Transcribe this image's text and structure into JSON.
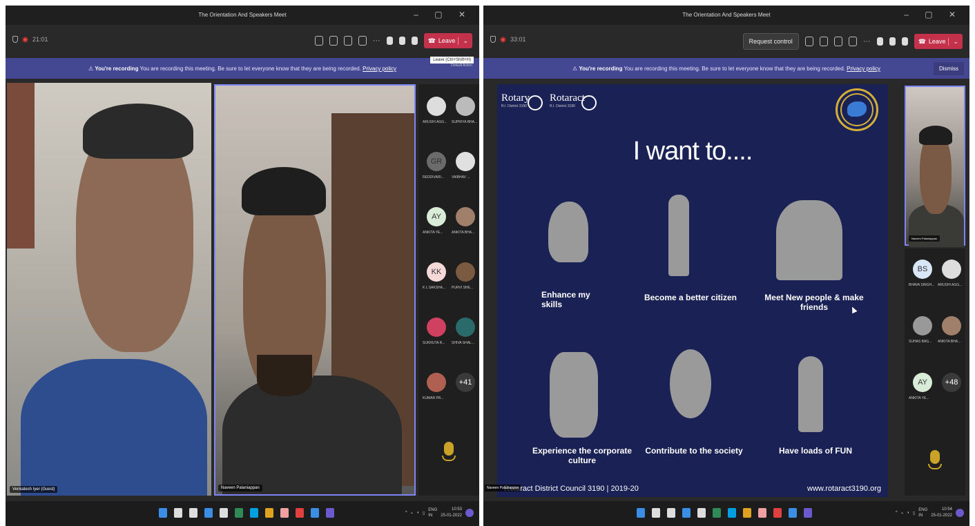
{
  "left_window": {
    "title": "The Orientation And Speakers Meet",
    "timer": "21:01",
    "leave_label": "Leave",
    "leave_tooltip": "Leave (Ctrl+Shift+H)",
    "tooltip_sub": "Default Action",
    "banner_bold": "You're recording",
    "banner_text": "You are recording this meeting. Be sure to let everyone know that they are being recorded.",
    "banner_link": "Privacy policy",
    "video1_name": "Venkatesh Iyer (Guest)",
    "video2_name": "Naveen Palaniappan",
    "roster": [
      {
        "name": "ARUSHI AGG...",
        "initials": "",
        "color": "#ddd"
      },
      {
        "name": "SUPRIYA BHA...",
        "initials": "",
        "color": "#bbb"
      },
      {
        "name": "REDDIVARI...",
        "initials": "GR",
        "color": "#6b6b6b"
      },
      {
        "name": "VAIBHAV ...",
        "initials": "",
        "color": "#e0e0e0"
      },
      {
        "name": "ANKITA YE...",
        "initials": "AY",
        "color": "#d9ecd8"
      },
      {
        "name": "ANKITA BHA...",
        "initials": "",
        "color": "#a0806a"
      },
      {
        "name": "K L SAKSHA...",
        "initials": "KK",
        "color": "#f6d8d8"
      },
      {
        "name": "PURVI SHE...",
        "initials": "",
        "color": "#7a5a40"
      },
      {
        "name": "SUKRUTA R...",
        "initials": "",
        "color": "#d04060"
      },
      {
        "name": "SHIVA SHAL...",
        "initials": "",
        "color": "#2a6a6a"
      },
      {
        "name": "KUMAR PR...",
        "initials": "",
        "color": "#b06050"
      },
      {
        "name": "",
        "initials": "+41",
        "color": "#3a3a3a"
      }
    ],
    "tray_lang": "ENG",
    "tray_region": "IN",
    "clock_time": "10:53",
    "clock_date": "25-01-2022"
  },
  "right_window": {
    "title": "The Orientation And Speakers Meet",
    "timer": "33:01",
    "request_control_label": "Request control",
    "leave_label": "Leave",
    "banner_bold": "You're recording",
    "banner_text": "You are recording this meeting. Be sure to let everyone know that they are being recorded.",
    "banner_link": "Privacy policy",
    "dismiss_label": "Dismiss",
    "slide": {
      "rotary": "Rotary",
      "rotary_sub": "R.I. District 3190",
      "rotaract": "Rotaract",
      "rotaract_sub": "R.I. District 3190",
      "title": "I want to....",
      "items": [
        "Enhance my skills",
        "Become a better citizen",
        "Meet New people & make friends",
        "Experience the corporate culture",
        "Contribute to the society",
        "Have loads of FUN"
      ],
      "footer_left": "Rotaract District Council 3190 | 2019-20",
      "footer_right": "www.rotaract3190.org"
    },
    "presenter_label": "Naveen Palaniappan",
    "video_name": "Naveen Palaniappan",
    "roster": [
      {
        "name": "BHAVA SINGH...",
        "initials": "BS",
        "color": "#d8e6f8"
      },
      {
        "name": "ARUSHI AGG...",
        "initials": "",
        "color": "#ddd"
      },
      {
        "name": "SUHAS BAG...",
        "initials": "",
        "color": "#999"
      },
      {
        "name": "ANKITA BHA...",
        "initials": "",
        "color": "#a0806a"
      },
      {
        "name": "ANKITA YE...",
        "initials": "AY",
        "color": "#d9ecd8"
      },
      {
        "name": "",
        "initials": "+48",
        "color": "#3a3a3a"
      }
    ],
    "tray_lang": "ENG",
    "tray_region": "IN",
    "clock_time": "10:54",
    "clock_date": "25-01-2022"
  },
  "colors": {
    "accent": "#7f85f5",
    "leave": "#c4314b",
    "banner": "#444791",
    "slide_bg": "#1a2155"
  }
}
